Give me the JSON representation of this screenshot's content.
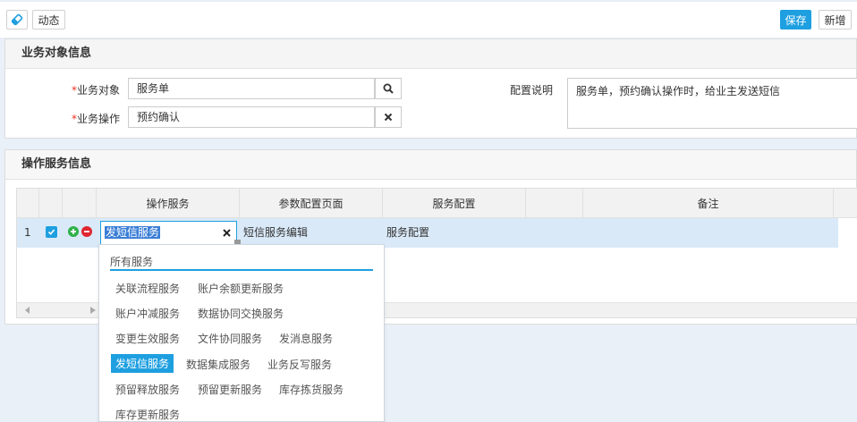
{
  "toolbar": {
    "dynamic_label": "动态",
    "save_label": "保存",
    "add_label": "新增"
  },
  "business_panel": {
    "title": "业务对象信息",
    "object_label": "业务对象",
    "object_value": "服务单",
    "operation_label": "业务操作",
    "operation_value": "预约确认",
    "config_label": "配置说明",
    "config_value": "服务单，预约确认操作时，给业主发送短信"
  },
  "service_panel": {
    "title": "操作服务信息",
    "columns": [
      "操作服务",
      "参数配置页面",
      "服务配置",
      "",
      "备注"
    ],
    "row": {
      "index": "1",
      "service_input": "发短信服务",
      "param_page": "短信服务编辑",
      "service_config": "服务配置"
    }
  },
  "dropdown": {
    "header": "所有服务",
    "items": [
      "关联流程服务",
      "账户余额更新服务",
      "账户冲减服务",
      "数据协同交换服务",
      "变更生效服务",
      "文件协同服务",
      "发消息服务",
      "发短信服务",
      "数据集成服务",
      "业务反写服务",
      "预留释放服务",
      "预留更新服务",
      "库存拣货服务",
      "库存更新服务"
    ],
    "selected": "发短信服务"
  },
  "colors": {
    "primary": "#1e9fe0",
    "required": "#ee3322",
    "add_icon": "#2fb14a",
    "remove_icon": "#e0262f",
    "selected_row": "#d9e9f8"
  }
}
